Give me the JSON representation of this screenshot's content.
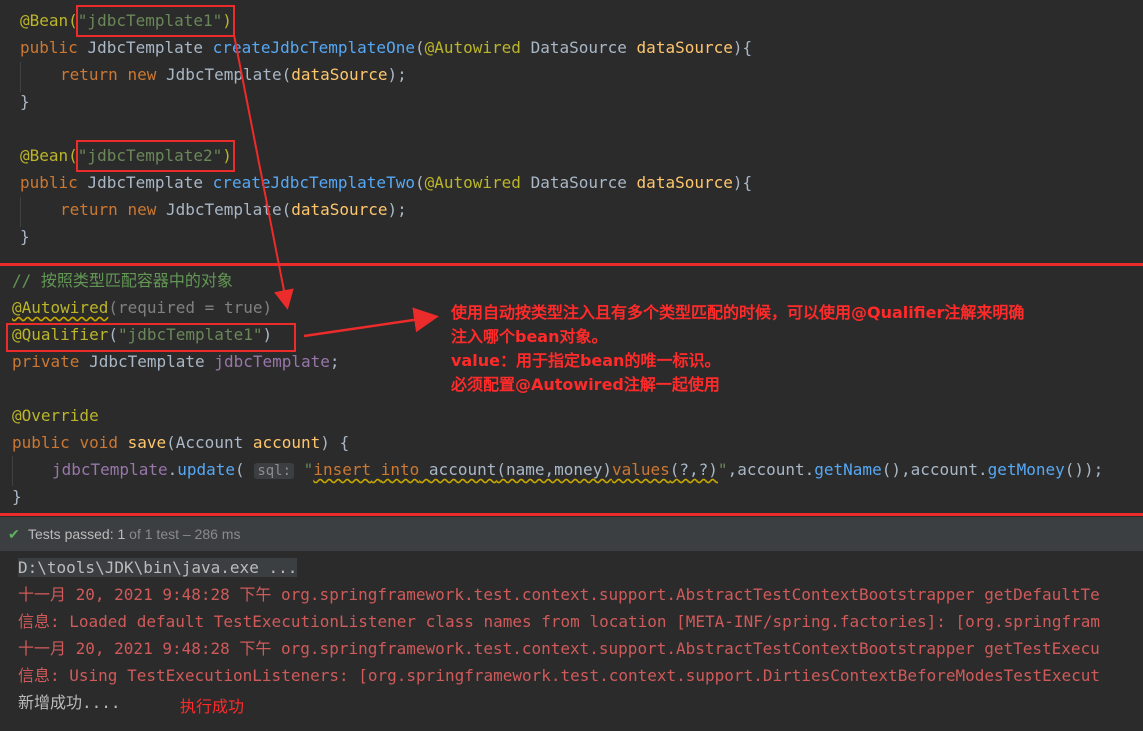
{
  "top_code": {
    "bean1_annotation": "@Bean(",
    "bean1_name": "\"jdbcTemplate1\"",
    "bean1_close": ")",
    "bean1_public": "public",
    "bean1_type": "JdbcTemplate",
    "bean1_method": "createJdbcTemplateOne",
    "bean1_params_open": "(",
    "bean1_autowired": "@Autowired",
    "bean1_ds_type": "DataSource",
    "bean1_ds_name": "dataSource",
    "bean1_params_close": "){",
    "bean1_return": "return",
    "bean1_new": "new",
    "bean1_ctor": "JdbcTemplate",
    "bean1_args_open": "(",
    "bean1_arg": "dataSource",
    "bean1_args_close": ");",
    "bean1_end": "}",
    "bean2_annotation": "@Bean(",
    "bean2_name": "\"jdbcTemplate2\"",
    "bean2_close": ")",
    "bean2_public": "public",
    "bean2_type": "JdbcTemplate",
    "bean2_method": "createJdbcTemplateTwo",
    "bean2_params_open": "(",
    "bean2_autowired": "@Autowired",
    "bean2_ds_type": "DataSource",
    "bean2_ds_name": "dataSource",
    "bean2_params_close": "){",
    "bean2_return": "return",
    "bean2_new": "new",
    "bean2_ctor": "JdbcTemplate",
    "bean2_args_open": "(",
    "bean2_arg": "dataSource",
    "bean2_args_close": ");",
    "bean2_end": "}"
  },
  "mid_code": {
    "comment": "// 按照类型匹配容器中的对象",
    "autowired": "@Autowired",
    "autowired_open": "(",
    "required_key": "required",
    "required_eq": " = ",
    "required_val": "true",
    "autowired_close": ")",
    "qualifier": "@Qualifier",
    "qualifier_open": "(",
    "qualifier_val": "\"jdbcTemplate1\"",
    "qualifier_close": ")",
    "field_private": "private",
    "field_type": "JdbcTemplate",
    "field_name": "jdbcTemplate",
    "field_semi": ";",
    "override": "@Override",
    "save_public": "public",
    "save_void": "void",
    "save_name": "save",
    "save_open": "(",
    "save_param_type": "Account",
    "save_param_name": "account",
    "save_close": ") {",
    "update_target": "jdbcTemplate",
    "update_dot": ".",
    "update_call": "update",
    "update_open": "(",
    "hint_label": "sql:",
    "sql_q1": "\"",
    "sql_insert": "insert",
    "sql_sp1": " ",
    "sql_into": "into",
    "sql_sp2": " ",
    "sql_table": "account",
    "sql_cols": "(name,money)",
    "sql_values": "values",
    "sql_params": "(?,?)",
    "sql_q2": "\"",
    "update_rest1": ",account.",
    "getname": "getName",
    "update_rest2": "(),account.",
    "getmoney": "getMoney",
    "update_rest3": "());",
    "save_end": "}"
  },
  "annotation_note": {
    "line1": "使用自动按类型注入且有多个类型匹配的时候，可以使用@Qualifier注解来明确",
    "line2": "注入哪个bean对象。",
    "line3": "value：用于指定bean的唯一标识。",
    "line4": "必须配置@Autowired注解一起使用"
  },
  "status_bar": {
    "check_icon": "✔",
    "tests_label": "Tests passed: ",
    "passed_count": "1",
    "total_text": " of 1 test – 286 ms"
  },
  "console": {
    "line1": "D:\\tools\\JDK\\bin\\java.exe ...",
    "line2": "十一月 20, 2021 9:48:28 下午 org.springframework.test.context.support.AbstractTestContextBootstrapper getDefaultTe",
    "line3": "信息: Loaded default TestExecutionListener class names from location [META-INF/spring.factories]: [org.springfram",
    "line4": "十一月 20, 2021 9:48:28 下午 org.springframework.test.context.support.AbstractTestContextBootstrapper getTestExecu",
    "line5": "信息: Using TestExecutionListeners: [org.springframework.test.context.support.DirtiesContextBeforeModesTestExecut",
    "line6": "新增成功....",
    "success_note": "执行成功"
  },
  "colors": {
    "annotation_red": "#ec2b2b",
    "editor_bg": "#2b2b2b",
    "console_error": "#d05a5a",
    "test_pass": "#5fb35f"
  }
}
